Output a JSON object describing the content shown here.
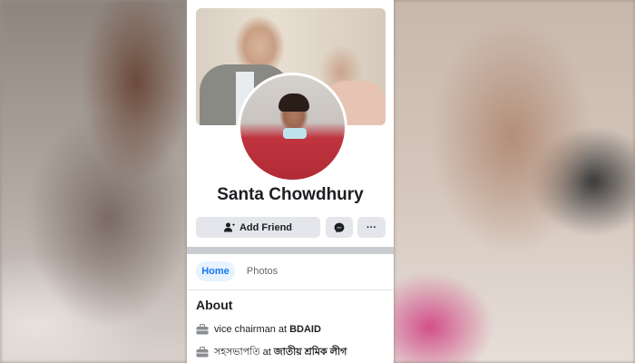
{
  "profile": {
    "name": "Santa Chowdhury"
  },
  "actions": {
    "add_friend_label": "Add Friend",
    "messenger_icon": "messenger-icon",
    "more_label": "···"
  },
  "tabs": [
    {
      "label": "Home",
      "active": true
    },
    {
      "label": "Photos",
      "active": false
    }
  ],
  "about": {
    "heading": "About",
    "items": [
      {
        "icon": "briefcase-icon",
        "prefix": "vice chairman at",
        "org": "BDAID"
      },
      {
        "icon": "briefcase-icon",
        "prefix": "সহসভাপতি at",
        "org": "জাতীয় শ্রমিক লীগ"
      }
    ]
  },
  "colors": {
    "accent": "#1877f2",
    "button_bg": "#e4e6eb",
    "tab_active_bg": "#e7f3ff",
    "text": "#1c1e21",
    "muted": "#65676b"
  }
}
